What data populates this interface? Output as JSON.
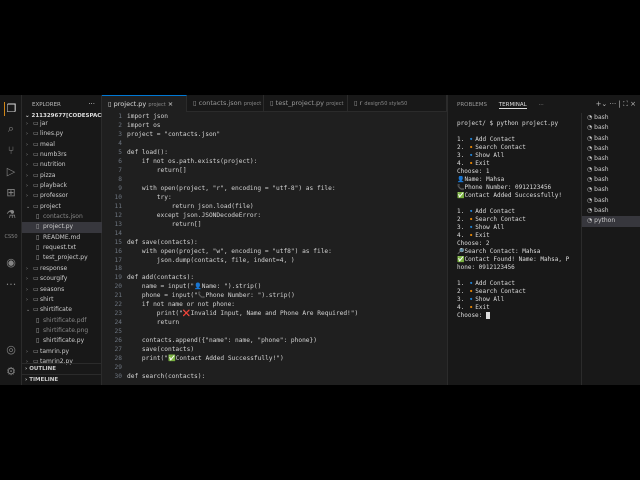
{
  "explorer": {
    "title": "EXPLORER",
    "root": "211329677[CODESPACES]:...",
    "items": [
      {
        "label": "jar",
        "type": "folder",
        "open": false,
        "depth": 0
      },
      {
        "label": "lines.py",
        "type": "folder",
        "open": false,
        "depth": 0
      },
      {
        "label": "meal",
        "type": "folder",
        "open": false,
        "depth": 0
      },
      {
        "label": "numb3rs",
        "type": "folder",
        "open": false,
        "depth": 0
      },
      {
        "label": "nutrition",
        "type": "folder",
        "open": false,
        "depth": 0
      },
      {
        "label": "pizza",
        "type": "folder",
        "open": false,
        "depth": 0
      },
      {
        "label": "playback",
        "type": "folder",
        "open": false,
        "depth": 0
      },
      {
        "label": "professor",
        "type": "folder",
        "open": false,
        "depth": 0
      },
      {
        "label": "project",
        "type": "folder",
        "open": true,
        "depth": 0
      },
      {
        "label": "contacts.json",
        "type": "file",
        "depth": 1,
        "dim": true
      },
      {
        "label": "project.py",
        "type": "file",
        "depth": 1,
        "selected": true
      },
      {
        "label": "README.md",
        "type": "file",
        "depth": 1
      },
      {
        "label": "request.txt",
        "type": "file",
        "depth": 1
      },
      {
        "label": "test_project.py",
        "type": "file",
        "depth": 1
      },
      {
        "label": "response",
        "type": "folder",
        "open": false,
        "depth": 0
      },
      {
        "label": "scourgify",
        "type": "folder",
        "open": false,
        "depth": 0
      },
      {
        "label": "seasons",
        "type": "folder",
        "open": false,
        "depth": 0
      },
      {
        "label": "shirt",
        "type": "folder",
        "open": false,
        "depth": 0
      },
      {
        "label": "shirtificate",
        "type": "folder",
        "open": true,
        "depth": 0
      },
      {
        "label": "shirtificate.pdf",
        "type": "file",
        "depth": 1,
        "dim": true
      },
      {
        "label": "shirtificate.png",
        "type": "file",
        "depth": 1,
        "dim": true
      },
      {
        "label": "shirtificate.py",
        "type": "file",
        "depth": 1
      },
      {
        "label": "tamrin.py",
        "type": "folder",
        "open": false,
        "depth": 0
      },
      {
        "label": "tamrin2.py",
        "type": "folder",
        "open": false,
        "depth": 0
      }
    ],
    "outline": "OUTLINE",
    "timeline": "TIMELINE"
  },
  "activity": [
    "files-icon",
    "search-icon",
    "source-control-icon",
    "run-debug-icon",
    "extensions-icon",
    "testing-icon",
    "cs50-icon",
    "github-icon",
    "more-icon",
    "account-icon",
    "settings-icon"
  ],
  "activity_cs50": "CS50",
  "tabs": [
    {
      "label": "project.py",
      "hint": "project",
      "active": true,
      "close": "×"
    },
    {
      "label": "contacts.json",
      "hint": "project"
    },
    {
      "label": "test_project.py",
      "hint": "project"
    },
    {
      "label": "r",
      "hint": "design50  style50"
    }
  ],
  "code": [
    "import json",
    "import os",
    "project = \"contacts.json\"",
    "",
    "def load():",
    "    if not os.path.exists(project):",
    "        return[]",
    "",
    "    with open(project, \"r\", encoding = \"utf-8\") as file:",
    "        try:",
    "            return json.load(file)",
    "        except json.JSONDecodeError:",
    "            return[]",
    "",
    "def save(contacts):",
    "    with open(project, \"w\", encoding = \"utf8\") as file:",
    "        json.dump(contacts, file, indent=4, )",
    "",
    "def add(contacts):",
    "    name = input(\"👤Name: \").strip()",
    "    phone = input(\"📞Phone Number: \").strip()",
    "    if not name or not phone:",
    "        print(\"❌Invalid Input, Name and Phone Are Required!\")",
    "        return",
    "",
    "    contacts.append({\"name\": name, \"phone\": phone})",
    "    save(contacts)",
    "    print(\"✅Contact Added Successfully!\")",
    "",
    "def search(contacts):"
  ],
  "panel": {
    "tabs": [
      "PROBLEMS",
      "TERMINAL"
    ],
    "active": "TERMINAL",
    "more": "···",
    "actions": "+⌄ ··· | ⛶ ×"
  },
  "terminal": [
    "project/ $ python project.py",
    "",
    "1. 🔹Add Contact",
    "2. 🔸Search Contact",
    "3. 🔹Show All",
    "4. 🔸Exit",
    "Choose: 1",
    "👤Name: Mahsa",
    "📞Phone Number: 0912123456",
    "✅Contact Added Successfully!",
    "",
    "1. 🔹Add Contact",
    "2. 🔸Search Contact",
    "3. 🔹Show All",
    "4. 🔸Exit",
    "Choose: 2",
    "🔎Search Contact: Mahsa",
    "✅Contact Found! Name: Mahsa, P",
    "hone: 0912123456",
    "",
    "1. 🔹Add Contact",
    "2. 🔸Search Contact",
    "3. 🔹Show All",
    "4. 🔸Exit",
    "Choose: "
  ],
  "terminals": [
    "bash",
    "bash",
    "bash",
    "bash",
    "bash",
    "bash",
    "bash",
    "bash",
    "bash",
    "bash",
    "python"
  ],
  "active_terminal": 10
}
